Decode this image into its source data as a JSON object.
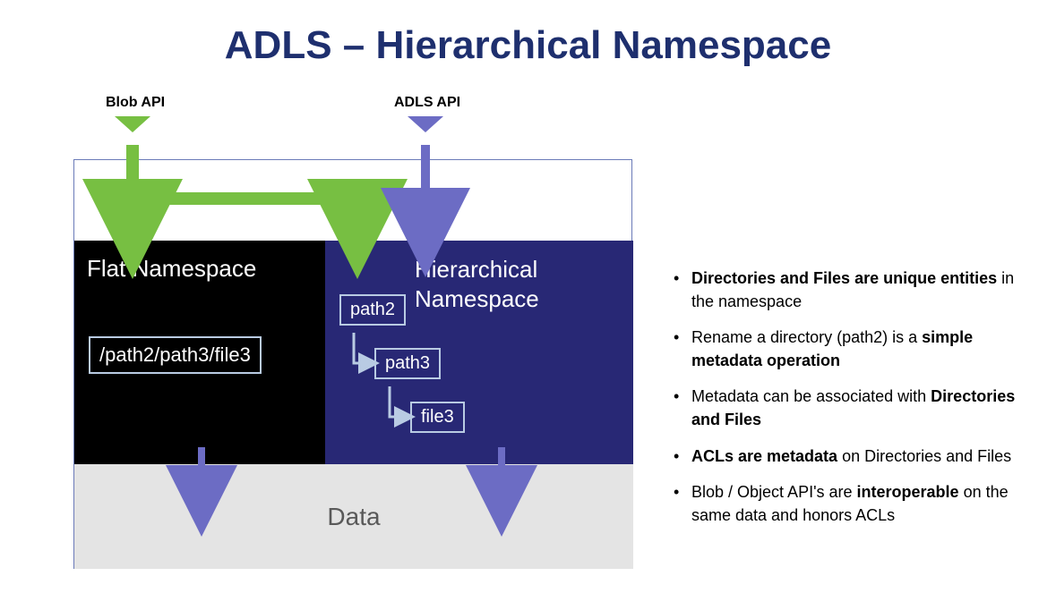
{
  "title": "ADLS – Hierarchical Namespace",
  "api": {
    "blob_label": "Blob API",
    "adls_label": "ADLS API"
  },
  "flat": {
    "title": "Flat Namespace",
    "path": "/path2/path3/file3"
  },
  "hier": {
    "title": "Hierarchical Namespace",
    "node1": "path2",
    "node2": "path3",
    "node3": "file3"
  },
  "data_label": "Data",
  "bullets": {
    "b1a": "Directories and Files are unique entities",
    "b1b": " in the namespace",
    "b2a": "Rename a directory (path2) is a ",
    "b2b": "simple metadata operation",
    "b3a": "Metadata can be associated with ",
    "b3b": "Directories and Files",
    "b4a": "ACLs are metadata",
    "b4b": " on Directories and Files",
    "b5a": "Blob / Object API's are ",
    "b5b": "interoperable",
    "b5c": " on the same data and honors ACLs"
  },
  "colors": {
    "title": "#1e2f6e",
    "green": "#77bf42",
    "purple": "#6c6cc4",
    "hier_bg": "#282875",
    "flat_bg": "#000000",
    "data_bg": "#e4e4e4"
  }
}
